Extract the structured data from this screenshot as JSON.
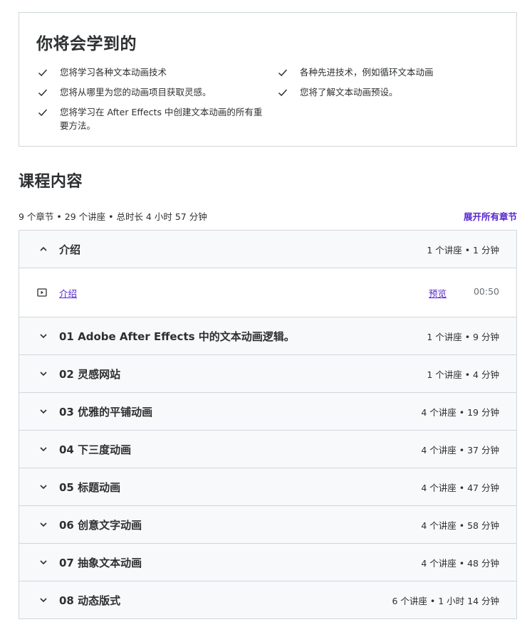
{
  "learn": {
    "title": "你将会学到的",
    "col1": [
      "您将学习各种文本动画技术",
      "您将从哪里为您的动画项目获取灵感。",
      "您将学习在 After Effects 中创建文本动画的所有重要方法。"
    ],
    "col2": [
      "各种先进技术，例如循环文本动画",
      "您将了解文本动画预设。"
    ]
  },
  "content": {
    "title": "课程内容",
    "summary": "9 个章节 • 29 个讲座 • 总时长 4 小时 57 分钟",
    "expand_all": "展开所有章节"
  },
  "sections": [
    {
      "title": "介绍",
      "meta": "1 个讲座 • 1 分钟",
      "expanded": true,
      "lectures": [
        {
          "title": "介绍",
          "preview": "预览",
          "duration": "00:50"
        }
      ]
    },
    {
      "title": "01 Adobe After Effects 中的文本动画逻辑。",
      "meta": "1 个讲座 • 9 分钟"
    },
    {
      "title": "02 灵感网站",
      "meta": "1 个讲座 • 4 分钟"
    },
    {
      "title": "03 优雅的平铺动画",
      "meta": "4 个讲座 • 19 分钟"
    },
    {
      "title": "04 下三度动画",
      "meta": "4 个讲座 • 37 分钟"
    },
    {
      "title": "05 标题动画",
      "meta": "4 个讲座 • 47 分钟"
    },
    {
      "title": "06 创意文字动画",
      "meta": "4 个讲座 • 58 分钟"
    },
    {
      "title": "07 抽象文本动画",
      "meta": "4 个讲座 • 48 分钟"
    },
    {
      "title": "08 动态版式",
      "meta": "6 个讲座 • 1 小时 14 分钟"
    }
  ],
  "icons": {
    "check": "check-icon",
    "chevron_up": "chevron-up-icon",
    "chevron_down": "chevron-down-icon",
    "play": "video-play-icon"
  },
  "colors": {
    "accent": "#5624d0",
    "text": "#2d2f31",
    "border": "#d1d7dc",
    "header_bg": "#f7f9fa"
  }
}
